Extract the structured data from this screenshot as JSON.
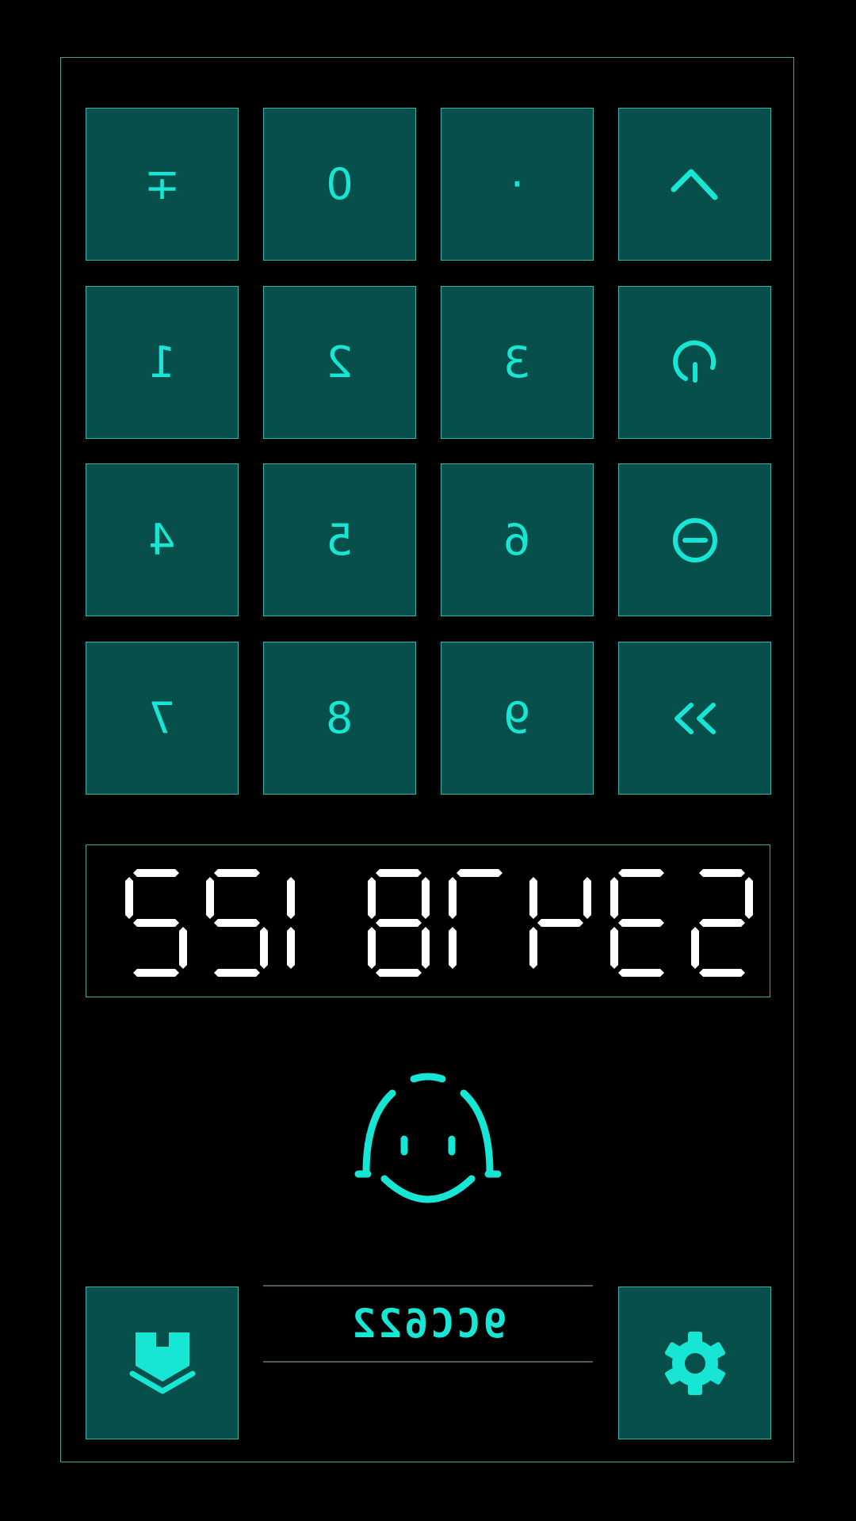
{
  "colors": {
    "accent": "#17e6d5",
    "key_background": "#064f4b",
    "key_border": "#2fb3a8",
    "frame_border": "#3aa79c",
    "display_digits": "#ffffff",
    "background": "#000000"
  },
  "keypad": {
    "rows": [
      [
        {
          "label": "∓",
          "name": "plus-minus-key"
        },
        {
          "label": "0",
          "name": "digit-0-key"
        },
        {
          "label": "·",
          "name": "decimal-point-key"
        },
        {
          "icon": "caret-up-icon",
          "name": "caret-up-key"
        }
      ],
      [
        {
          "label": "1",
          "name": "digit-1-key",
          "mirrored": true
        },
        {
          "label": "2",
          "name": "digit-2-key",
          "mirrored": true
        },
        {
          "label": "3",
          "name": "digit-3-key",
          "mirrored": true
        },
        {
          "icon": "power-icon",
          "name": "power-key"
        }
      ],
      [
        {
          "label": "4",
          "name": "digit-4-key",
          "mirrored": true
        },
        {
          "label": "5",
          "name": "digit-5-key",
          "mirrored": true
        },
        {
          "label": "6",
          "name": "digit-6-key",
          "mirrored": true
        },
        {
          "icon": "minus-circle-icon",
          "name": "minus-circle-key"
        }
      ],
      [
        {
          "label": "7",
          "name": "digit-7-key",
          "mirrored": true
        },
        {
          "label": "8",
          "name": "digit-8-key",
          "mirrored": true
        },
        {
          "label": "9",
          "name": "digit-9-key",
          "mirrored": true
        },
        {
          "icon": "double-chevron-left-icon",
          "name": "double-chevron-left-key"
        }
      ]
    ]
  },
  "display": {
    "value": "53478122",
    "mirrored": true,
    "style": "seven-segment"
  },
  "mascot": {
    "icon": "smiley-face-icon"
  },
  "footer": {
    "left_button_icon": "download-tray-icon",
    "id_label": "9CC622",
    "right_button_icon": "gear-icon"
  }
}
